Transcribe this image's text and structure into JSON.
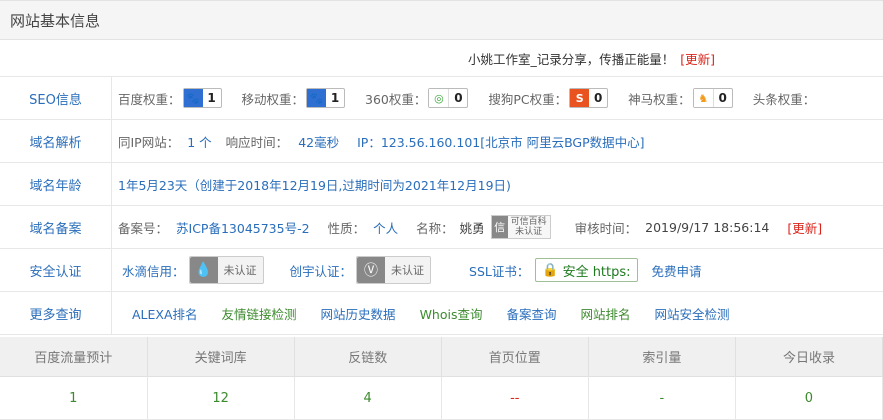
{
  "header": {
    "title": "网站基本信息"
  },
  "slogan": {
    "text": "小姚工作室_记录分享，传播正能量！",
    "update": "[更新]"
  },
  "seo": {
    "label": "SEO信息",
    "items": [
      {
        "name": "百度权重：",
        "value": "1",
        "icon": "baidu-paw-icon",
        "color": "#2f6fd1"
      },
      {
        "name": "移动权重：",
        "value": "1",
        "icon": "baidu-paw-icon",
        "color": "#2f6fd1"
      },
      {
        "name": "360权重：",
        "value": "0",
        "icon": "360-icon",
        "color": "#3aa63a"
      },
      {
        "name": "搜狗PC权重：",
        "value": "0",
        "icon": "sogou-icon",
        "color": "#e8531f"
      },
      {
        "name": "神马权重：",
        "value": "0",
        "icon": "shenma-icon",
        "color": "#f29a1c"
      },
      {
        "name": "头条权重："
      }
    ]
  },
  "dns": {
    "label": "域名解析",
    "sameip_label": "同IP网站：",
    "sameip_value": "1 个",
    "resp_label": "响应时间：",
    "resp_value": "42毫秒",
    "ip_text": "IP：123.56.160.101[北京市 阿里云BGP数据中心]"
  },
  "age": {
    "label": "域名年龄",
    "text": "1年5月23天（创建于2018年12月19日,过期时间为2021年12月19日)"
  },
  "icp": {
    "label": "域名备案",
    "no_label": "备案号：",
    "no_value": "苏ICP备13045735号-2",
    "nature_label": "性质：",
    "nature_value": "个人",
    "name_label": "名称：",
    "name_value": "姚勇",
    "badge_icon": "信",
    "badge_line1": "可信百科",
    "badge_line2": "未认证",
    "audit_label": "审核时间：",
    "audit_value": "2019/9/17 18:56:14",
    "update": "[更新]"
  },
  "security": {
    "label": "安全认证",
    "shuidi_label": "水滴信用：",
    "shuidi_badge": "未认证",
    "chuangyu_label": "创宇认证：",
    "chuangyu_badge": "未认证",
    "ssl_label": "SSL证书：",
    "ssl_badge": "安全 https:",
    "ssl_apply": "免费申请"
  },
  "more": {
    "label": "更多查询",
    "links": [
      "ALEXA排名",
      "友情链接检测",
      "网站历史数据",
      "Whois查询",
      "备案查询",
      "网站排名",
      "网站安全检测"
    ]
  },
  "stats": {
    "headers": [
      "百度流量预计",
      "关键词库",
      "反链数",
      "首页位置",
      "索引量",
      "今日收录"
    ],
    "values": [
      "1",
      "12",
      "4",
      "--",
      "-",
      "0"
    ]
  }
}
